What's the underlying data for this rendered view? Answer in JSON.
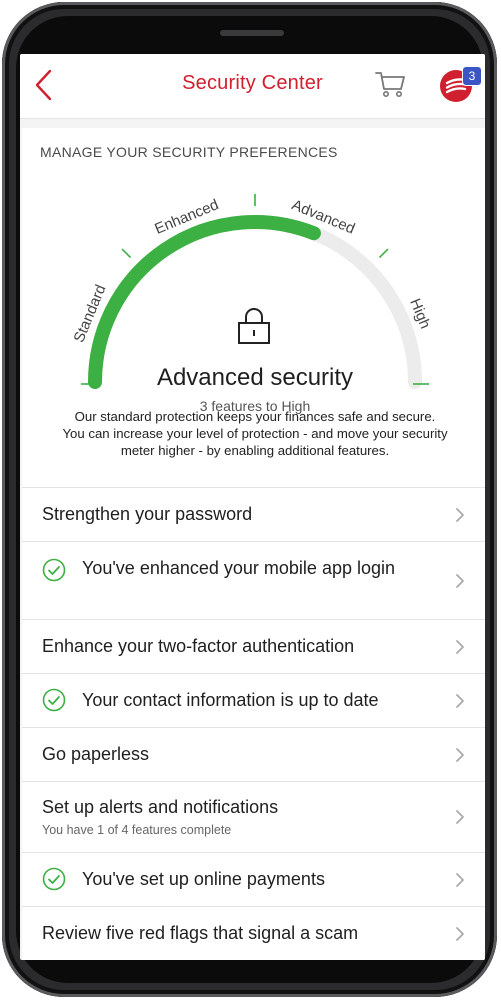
{
  "header": {
    "title": "Security Center",
    "cart_count": "3",
    "colors": {
      "brand": "#d0202f",
      "badge": "#3b55c4",
      "gauge_fill": "#3cb043"
    }
  },
  "security": {
    "section_title": "MANAGE YOUR SECURITY PREFERENCES",
    "gauge_labels": [
      "Standard",
      "Enhanced",
      "Advanced",
      "High"
    ],
    "current_level": "Advanced security",
    "remaining": "3 features to High",
    "level_fraction": 0.62,
    "description": "Our standard protection keeps your finances safe and secure. You can increase your level of protection - and move your security meter higher - by enabling additional features."
  },
  "items": [
    {
      "label": "Strengthen your password",
      "done": false,
      "icon": "chevron-right-icon"
    },
    {
      "label": "You've enhanced your mobile app login",
      "done": true,
      "icon": "check-circle-icon"
    },
    {
      "label": "Enhance your two-factor authentication",
      "done": false,
      "icon": "chevron-right-icon"
    },
    {
      "label": "Your contact information is up to date",
      "done": true,
      "icon": "check-circle-icon"
    },
    {
      "label": "Go paperless",
      "done": false,
      "icon": "chevron-right-icon"
    },
    {
      "label": "Set up alerts and notifications",
      "sub": "You have 1 of 4 features complete",
      "done": false,
      "icon": "chevron-right-icon"
    },
    {
      "label": "You've set up online payments",
      "done": true,
      "icon": "check-circle-icon"
    },
    {
      "label": "Review five red flags that signal a scam",
      "done": false,
      "icon": "chevron-right-icon"
    }
  ]
}
